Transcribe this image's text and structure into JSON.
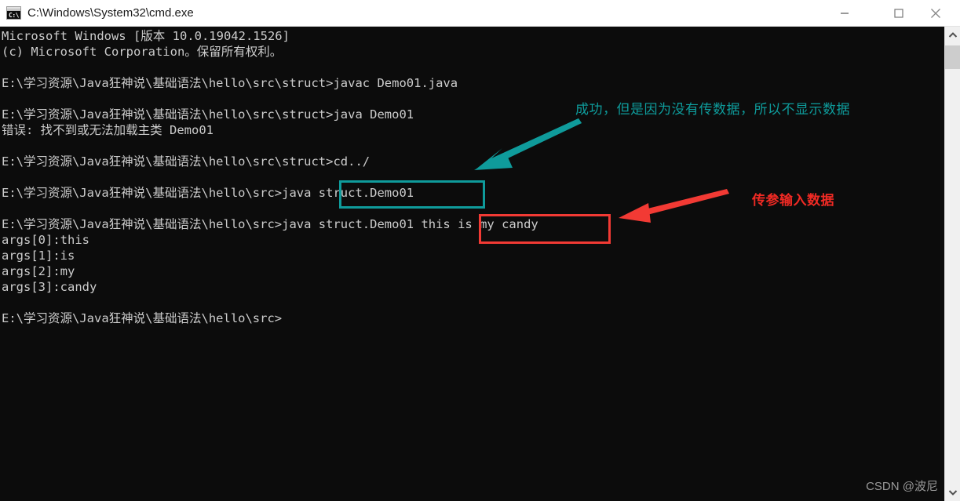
{
  "window": {
    "title": "C:\\Windows\\System32\\cmd.exe",
    "app_icon": "cmd-console-icon",
    "icon_prompt_text": "C:\\",
    "controls": {
      "minimize": "minimize-button",
      "maximize": "maximize-button",
      "close": "close-button"
    }
  },
  "console": {
    "background_color": "#0c0c0c",
    "text_color": "#cccccc",
    "lines": [
      "Microsoft Windows [版本 10.0.19042.1526]",
      "(c) Microsoft Corporation。保留所有权利。",
      "",
      "E:\\学习资源\\Java狂神说\\基础语法\\hello\\src\\struct>javac Demo01.java",
      "",
      "E:\\学习资源\\Java狂神说\\基础语法\\hello\\src\\struct>java Demo01",
      "错误: 找不到或无法加载主类 Demo01",
      "",
      "E:\\学习资源\\Java狂神说\\基础语法\\hello\\src\\struct>cd../",
      "",
      "E:\\学习资源\\Java狂神说\\基础语法\\hello\\src>java struct.Demo01",
      "",
      "E:\\学习资源\\Java狂神说\\基础语法\\hello\\src>java struct.Demo01 this is my candy",
      "args[0]:this",
      "args[1]:is",
      "args[2]:my",
      "args[3]:candy",
      "",
      "E:\\学习资源\\Java狂神说\\基础语法\\hello\\src>"
    ],
    "full_text": "Microsoft Windows [版本 10.0.19042.1526]\n(c) Microsoft Corporation。保留所有权利。\n\nE:\\学习资源\\Java狂神说\\基础语法\\hello\\src\\struct>javac Demo01.java\n\nE:\\学习资源\\Java狂神说\\基础语法\\hello\\src\\struct>java Demo01\n错误: 找不到或无法加载主类 Demo01\n\nE:\\学习资源\\Java狂神说\\基础语法\\hello\\src\\struct>cd../\n\nE:\\学习资源\\Java狂神说\\基础语法\\hello\\src>java struct.Demo01\n\nE:\\学习资源\\Java狂神说\\基础语法\\hello\\src>java struct.Demo01 this is my candy\nargs[0]:this\nargs[1]:is\nargs[2]:my\nargs[3]:candy\n\nE:\\学习资源\\Java狂神说\\基础语法\\hello\\src>"
  },
  "annotations": {
    "teal": {
      "label": "成功，但是因为没有传数据，所以不显示数据",
      "color": "#0e9c9c",
      "highlights": "java struct.Demo01"
    },
    "red": {
      "label": "传参输入数据",
      "color": "#f02a24",
      "highlights": "this is my candy"
    }
  },
  "scrollbar": {
    "up_arrow": "scroll-up-arrow",
    "down_arrow": "scroll-down-arrow",
    "thumb": "scroll-thumb"
  },
  "watermark": {
    "text": "CSDN @波尼"
  }
}
